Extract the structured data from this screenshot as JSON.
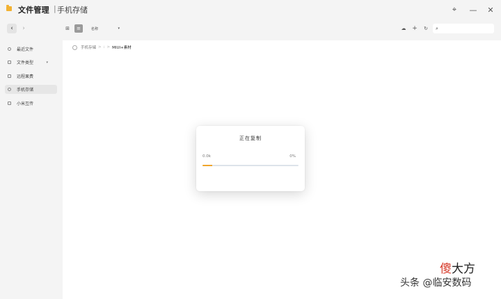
{
  "window": {
    "title": "文件管理",
    "separator": "|",
    "subtitle": "手机存储"
  },
  "titlebar_controls": {
    "pin": "⌖",
    "minimize": "—",
    "close": "✕"
  },
  "nav": {
    "back": "‹",
    "forward": "›"
  },
  "sidebar": {
    "items": [
      {
        "label": "最近文件"
      },
      {
        "label": "文件类型",
        "caret": "▾"
      },
      {
        "label": "远程果费"
      },
      {
        "label": "手机存储"
      },
      {
        "label": "小米互传"
      }
    ]
  },
  "toolbar": {
    "grid_view": "⊞",
    "list_view": "≡",
    "sort_label": "名称",
    "sort_caret": "▾",
    "cloud": "☁",
    "add": "+",
    "refresh": "↻",
    "search_icon": "⌕",
    "search_placeholder": ""
  },
  "breadcrumb": {
    "root": "手机存储",
    "sep1": ">",
    "ellipsis": ":",
    "sep2": ">",
    "current": "MIUI+素材"
  },
  "dialog": {
    "title": "正在复制",
    "left_value": "0.0k",
    "right_value": "0%",
    "progress_percent": 10,
    "accent_color": "#f0a52b"
  },
  "watermark": {
    "logo_first": "傻",
    "logo_rest": "大方",
    "text": "头条 @临安数码"
  }
}
